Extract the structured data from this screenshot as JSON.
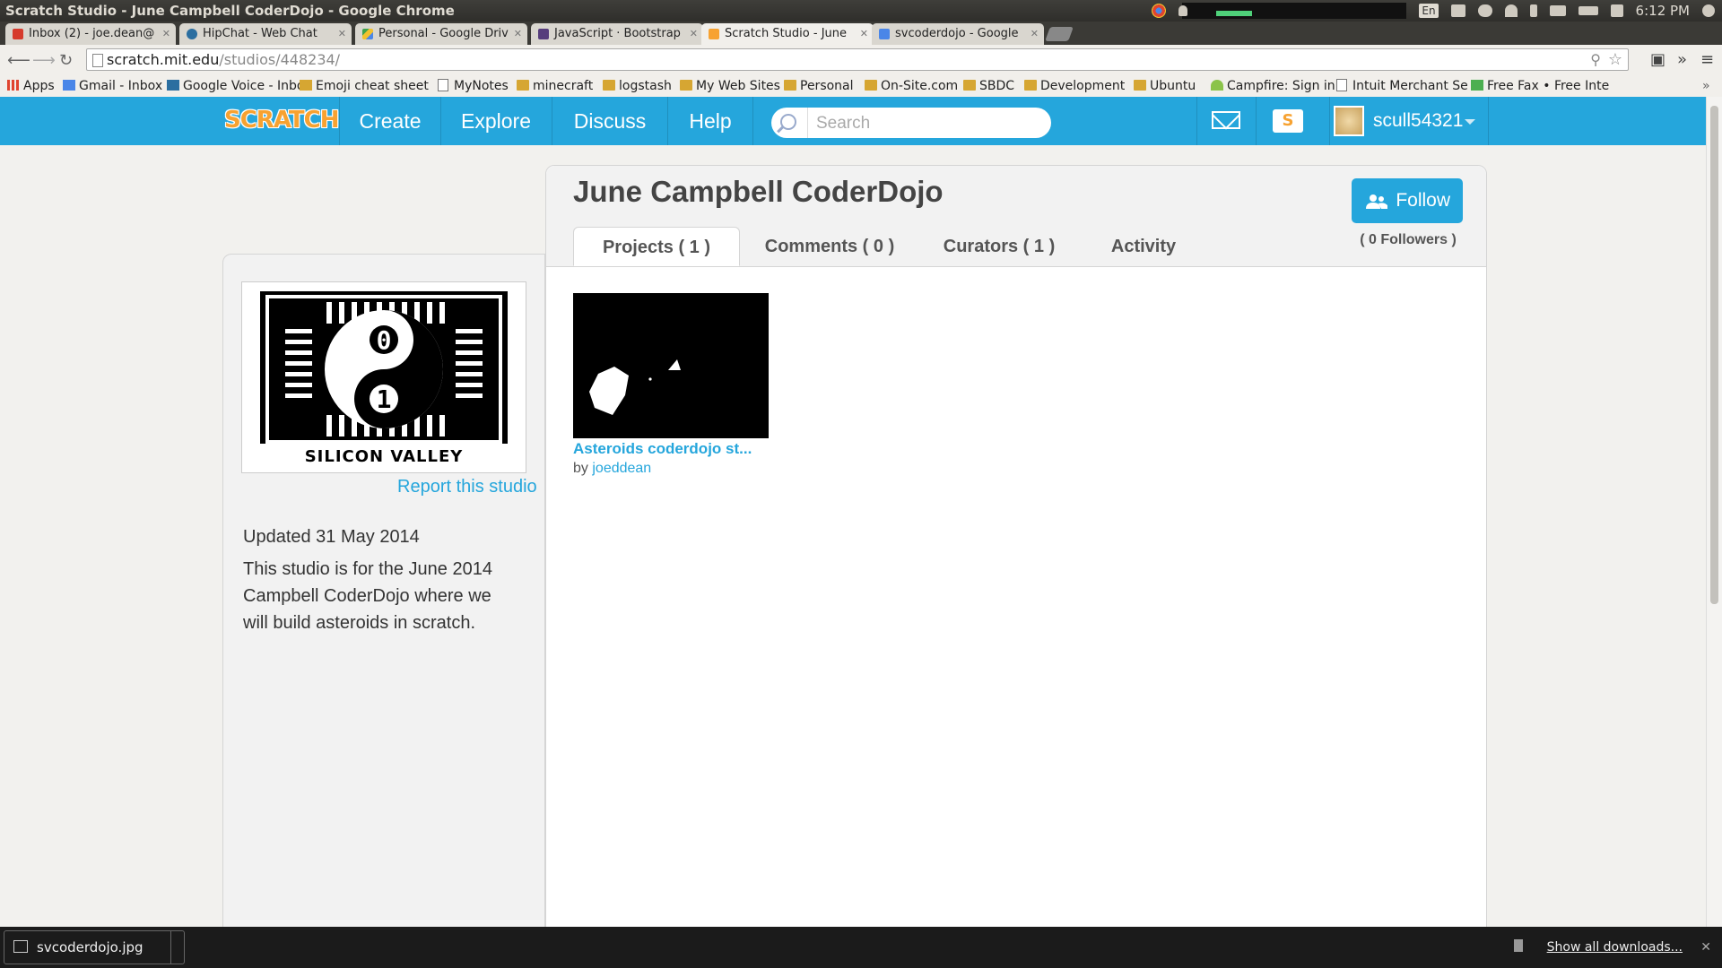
{
  "os": {
    "window_title": "Scratch Studio - June Campbell CoderDojo - Google Chrome",
    "lang": "En",
    "clock": "6:12 PM"
  },
  "tabs": [
    {
      "label": "Inbox (2) - joe.dean@",
      "color": "#d63b2d"
    },
    {
      "label": "HipChat - Web Chat",
      "color": "#2b6ea0"
    },
    {
      "label": "Personal - Google Driv",
      "color": "#3fa34d"
    },
    {
      "label": "JavaScript · Bootstrap",
      "color": "#563d7c"
    },
    {
      "label": "Scratch Studio - June",
      "color": "#f7a231",
      "active": true
    },
    {
      "label": "svcoderdojo - Google",
      "color": "#4a86e8"
    }
  ],
  "omnibox": {
    "host": "scratch.mit.edu",
    "path": "/studios/448234/"
  },
  "bookmarks": [
    {
      "label": "Apps",
      "type": "apps"
    },
    {
      "label": "Gmail - Inbox",
      "type": "page"
    },
    {
      "label": "Google Voice - Inbo",
      "type": "page"
    },
    {
      "label": "Emoji cheat sheet",
      "type": "page"
    },
    {
      "label": "MyNotes",
      "type": "page"
    },
    {
      "label": "minecraft",
      "type": "folder"
    },
    {
      "label": "logstash",
      "type": "folder"
    },
    {
      "label": "My Web Sites",
      "type": "folder"
    },
    {
      "label": "Personal",
      "type": "folder"
    },
    {
      "label": "On-Site.com",
      "type": "folder"
    },
    {
      "label": "SBDC",
      "type": "folder"
    },
    {
      "label": "Development",
      "type": "folder"
    },
    {
      "label": "Ubuntu",
      "type": "folder"
    },
    {
      "label": "Campfire: Sign in",
      "type": "page"
    },
    {
      "label": "Intuit Merchant Se",
      "type": "page"
    },
    {
      "label": "Free Fax • Free Inte",
      "type": "page"
    }
  ],
  "scratch_nav": {
    "logo": "SCRATCH",
    "create": "Create",
    "explore": "Explore",
    "discuss": "Discuss",
    "help": "Help",
    "search_placeholder": "Search",
    "mystuff_glyph": "S",
    "username": "scull54321"
  },
  "studio": {
    "title": "June Campbell CoderDojo",
    "follow_label": "Follow",
    "followers": "( 0 Followers )",
    "tabs": {
      "projects": "Projects ( 1 )",
      "comments": "Comments ( 0 )",
      "curators": "Curators ( 1 )",
      "activity": "Activity"
    },
    "logo_caption": "SILICON VALLEY",
    "logo_digits": {
      "top": "0",
      "bottom": "1"
    },
    "report": "Report this studio",
    "updated": "Updated 31 May 2014",
    "description": "This studio is for the June 2014 Campbell CoderDojo where we will build asteroids in scratch.",
    "projects": [
      {
        "title": "Asteroids coderdojo st...",
        "by": "by",
        "author": "joeddean"
      }
    ]
  },
  "downloads": {
    "file": "svcoderdojo.jpg",
    "show_all": "Show all downloads..."
  },
  "colors": {
    "scratch_blue": "#25a6dc",
    "scratch_orange": "#f7a231"
  }
}
